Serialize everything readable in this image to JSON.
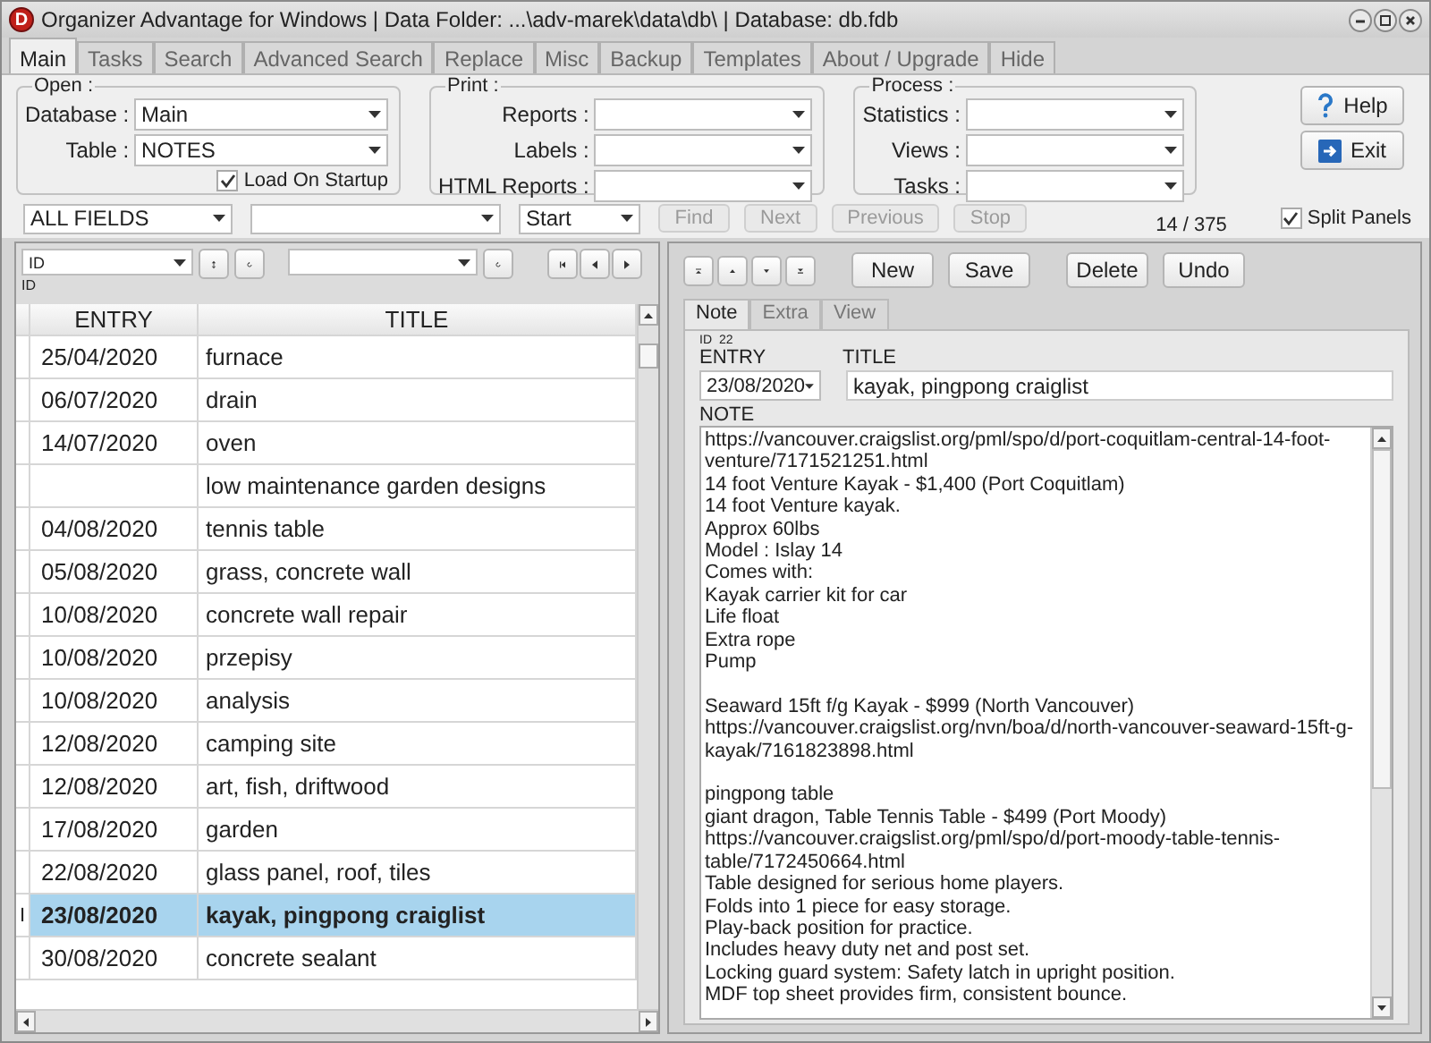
{
  "window": {
    "logo_letter": "D",
    "title": "Organizer Advantage for Windows | Data Folder: ...\\adv-marek\\data\\db\\ | Database: db.fdb"
  },
  "tabs": [
    {
      "label": "Main",
      "selected": true
    },
    {
      "label": "Tasks",
      "selected": false
    },
    {
      "label": "Search",
      "selected": false
    },
    {
      "label": "Advanced Search",
      "selected": false
    },
    {
      "label": "Replace",
      "selected": false
    },
    {
      "label": "Misc",
      "selected": false
    },
    {
      "label": "Backup",
      "selected": false
    },
    {
      "label": "Templates",
      "selected": false
    },
    {
      "label": "About / Upgrade",
      "selected": false
    },
    {
      "label": "Hide",
      "selected": false
    }
  ],
  "groups": [
    {
      "title": "Open :",
      "kind": "open",
      "fields": [
        {
          "label": "Database :",
          "value": "Main"
        },
        {
          "label": "Table :",
          "value": "NOTES"
        }
      ],
      "checkbox": {
        "label": "Load On Startup",
        "checked": true
      }
    },
    {
      "title": "Print :",
      "kind": "print",
      "fields": [
        {
          "label": "Reports :"
        },
        {
          "label": "Labels :"
        },
        {
          "label": "HTML Reports :"
        }
      ]
    },
    {
      "title": "Process :",
      "kind": "process",
      "fields": [
        {
          "label": "Statistics :"
        },
        {
          "label": "Views :"
        },
        {
          "label": "Tasks :"
        }
      ]
    }
  ],
  "side_buttons": [
    {
      "label": "Help",
      "kind": "help"
    },
    {
      "label": "Exit",
      "kind": "exit"
    }
  ],
  "search_bar": {
    "field": "ALL FIELDS",
    "mode": "Start",
    "buttons": [
      {
        "label": "Find",
        "disabled": true
      },
      {
        "label": "Next",
        "disabled": true
      },
      {
        "label": "Previous",
        "disabled": true
      },
      {
        "label": "Stop",
        "disabled": true
      }
    ],
    "record_count": "14 / 375",
    "split_panels": {
      "label": "Split Panels",
      "checked": true
    }
  },
  "left_panel": {
    "sort_field": "ID",
    "sort_caption": "ID",
    "table": {
      "columns": [
        "ENTRY",
        "TITLE"
      ],
      "rows": [
        {
          "entry": "25/04/2020",
          "title": "furnace",
          "selected": false
        },
        {
          "entry": "06/07/2020",
          "title": "drain",
          "selected": false
        },
        {
          "entry": "14/07/2020",
          "title": "oven",
          "selected": false
        },
        {
          "title": "low maintenance garden designs",
          "selected": false
        },
        {
          "entry": "04/08/2020",
          "title": "tennis table",
          "selected": false
        },
        {
          "entry": "05/08/2020",
          "title": "grass, concrete wall",
          "selected": false
        },
        {
          "entry": "10/08/2020",
          "title": "concrete wall repair",
          "selected": false
        },
        {
          "entry": "10/08/2020",
          "title": "przepisy",
          "selected": false
        },
        {
          "entry": "10/08/2020",
          "title": "analysis",
          "selected": false
        },
        {
          "entry": "12/08/2020",
          "title": "camping site",
          "selected": false
        },
        {
          "entry": "12/08/2020",
          "title": "art, fish, driftwood",
          "selected": false
        },
        {
          "entry": "17/08/2020",
          "title": "garden",
          "selected": false
        },
        {
          "entry": "22/08/2020",
          "title": "glass panel, roof, tiles",
          "selected": false
        },
        {
          "entry": "23/08/2020",
          "title": "kayak, pingpong craiglist",
          "selected": true,
          "marker": "I"
        },
        {
          "entry": "30/08/2020",
          "title": "concrete sealant",
          "selected": false
        }
      ]
    }
  },
  "right_panel": {
    "actions": [
      "New",
      "Save",
      "Delete",
      "Undo"
    ],
    "tabs": [
      {
        "label": "Note",
        "selected": true
      },
      {
        "label": "Extra",
        "selected": false
      },
      {
        "label": "View",
        "selected": false
      }
    ],
    "id_label": "ID",
    "id_value": "22",
    "entry_label": "ENTRY",
    "entry_value": "23/08/2020",
    "title_label": "TITLE",
    "title_value": "kayak, pingpong craiglist",
    "note_label": "NOTE",
    "note_blocks": [
      [
        "https://vancouver.craigslist.org/pml/spo/d/port-coquitlam-central-14-foot-",
        "venture/7171521251.html",
        "14 foot Venture Kayak - $1,400 (Port Coquitlam)",
        "14 foot Venture kayak.",
        "Approx 60lbs",
        "Model : Islay 14",
        "Comes with:",
        "Kayak carrier kit for car",
        "Life float",
        "Extra rope",
        "Pump"
      ],
      [
        "Seaward 15ft f/g Kayak - $999 (North Vancouver)",
        "https://vancouver.craigslist.org/nvn/boa/d/north-vancouver-seaward-15ft-g-",
        "kayak/7161823898.html"
      ],
      [
        "pingpong table",
        "giant dragon, Table Tennis Table - $499 (Port Moody)",
        "https://vancouver.craigslist.org/pml/spo/d/port-moody-table-tennis-",
        "table/7172450664.html",
        "Table designed for serious home players.",
        "Folds into 1 piece for easy storage.",
        "Play-back position for practice.",
        "Includes heavy duty net and post set.",
        "Locking guard system: Safety latch in upright position.",
        "MDF top sheet provides firm, consistent bounce."
      ]
    ]
  }
}
